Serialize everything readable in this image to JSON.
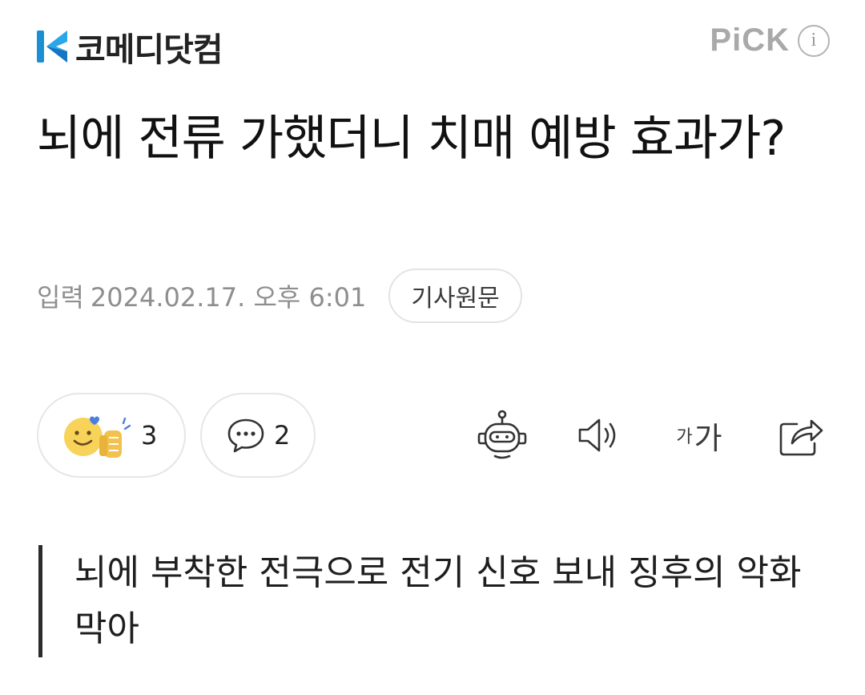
{
  "header": {
    "press_name": "코메디닷컴",
    "pick_label": "PiCK",
    "info_glyph": "i",
    "brand_color": "#1a8fd6"
  },
  "article": {
    "headline": "뇌에 전류 가했더니 치매 예방 효과가?",
    "date_prefix": "입력",
    "date_value": "2024.02.17. 오후 6:01",
    "origin_label": "기사원문",
    "subtitle": "뇌에 부착한 전극으로 전기 신호 보내 징후의 악화 막아"
  },
  "actions": {
    "reaction_count": "3",
    "comment_count": "2",
    "font_small": "가",
    "font_large": "가",
    "icons": {
      "reaction": "smiley-thumbs-up-icon",
      "comment": "speech-bubble-icon",
      "summary": "robot-summary-icon",
      "tts": "speaker-icon",
      "share": "share-icon"
    }
  }
}
